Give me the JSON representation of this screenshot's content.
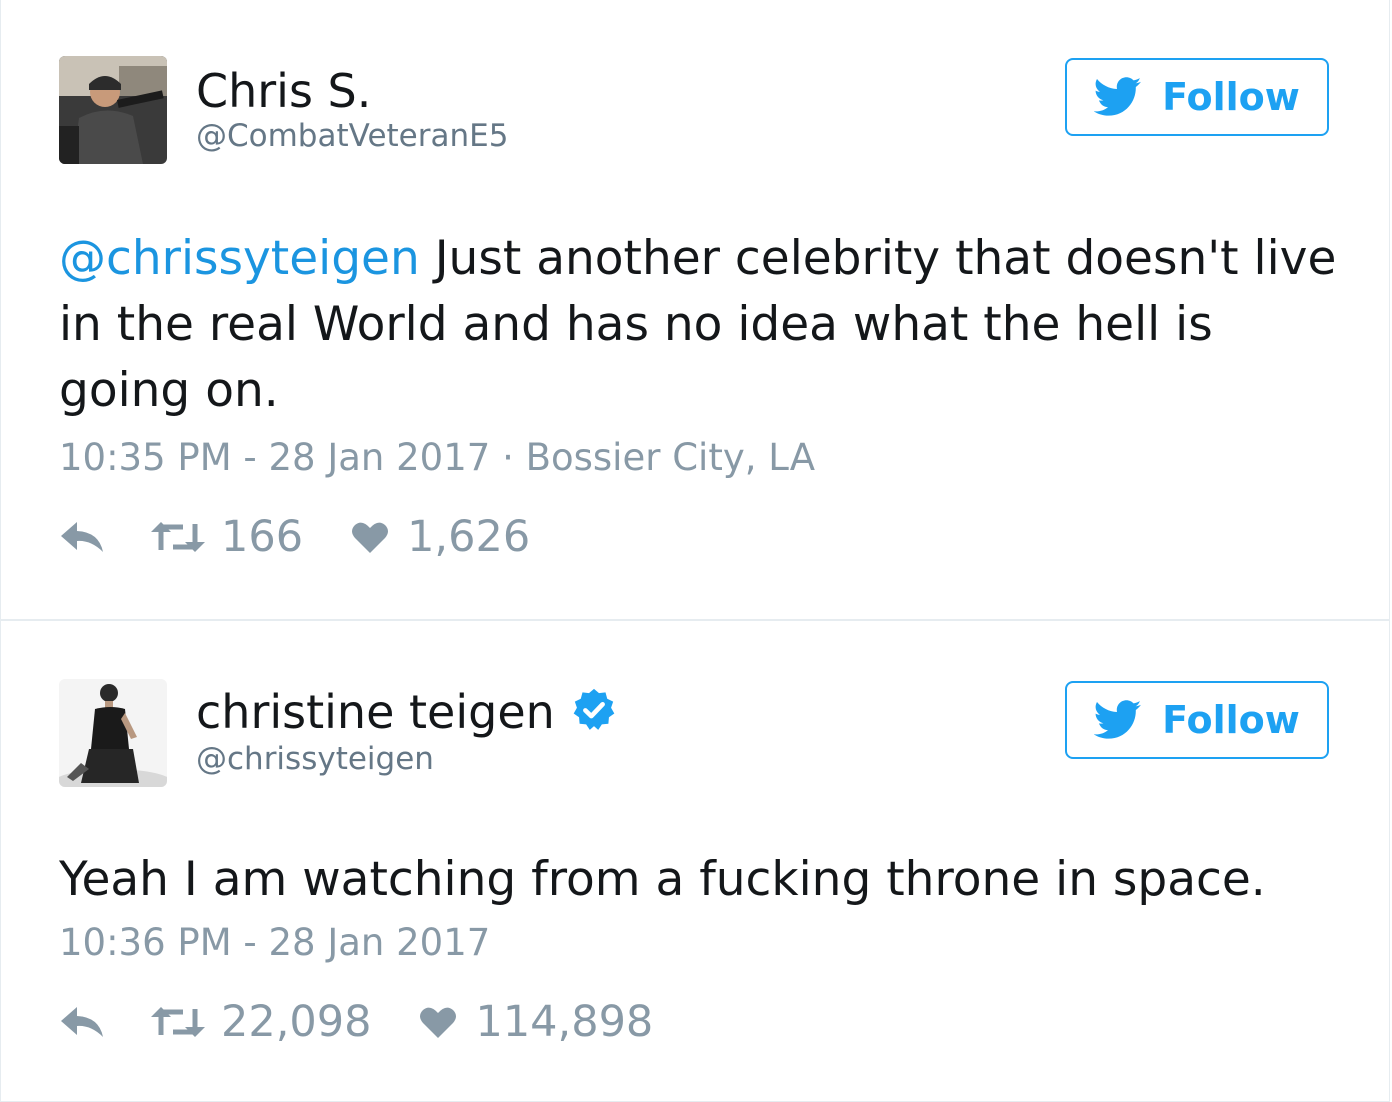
{
  "accent_color": "#1da1f2",
  "tweets": [
    {
      "display_name": "Chris S.",
      "handle": "@CombatVeteranE5",
      "verified": false,
      "follow_label": "Follow",
      "mention": "@chrissyteigen",
      "body": " Just another celebrity that doesn't live in the real World and has no idea what the hell is going on.",
      "timestamp": "10:35 PM - 28 Jan 2017",
      "separator": "·",
      "location": "Bossier City, LA",
      "retweets": "166",
      "likes": "1,626",
      "icons": [
        "reply-icon",
        "retweet-icon",
        "heart-icon",
        "twitter-bird-icon"
      ]
    },
    {
      "display_name": "christine teigen",
      "handle": "@chrissyteigen",
      "verified": true,
      "follow_label": "Follow",
      "body": "Yeah I am watching from a fucking throne in space.",
      "timestamp": "10:36 PM - 28 Jan 2017",
      "retweets": "22,098",
      "likes": "114,898",
      "icons": [
        "verified-badge-icon",
        "reply-icon",
        "retweet-icon",
        "heart-icon",
        "twitter-bird-icon"
      ]
    }
  ]
}
